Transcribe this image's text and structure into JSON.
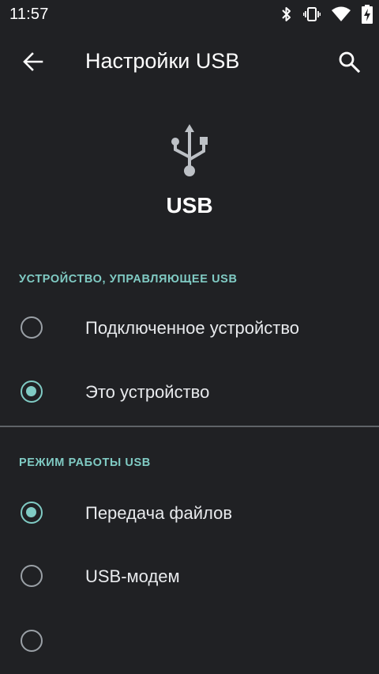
{
  "status_bar": {
    "time": "11:57",
    "icons": [
      "bluetooth-icon",
      "vibrate-icon",
      "wifi-icon",
      "battery-charging-icon"
    ]
  },
  "app_bar": {
    "back_icon": "arrow-back-icon",
    "title": "Настройки USB",
    "search_icon": "search-icon"
  },
  "hero": {
    "icon": "usb-icon",
    "title": "USB"
  },
  "sections": [
    {
      "header": "УСТРОЙСТВО, УПРАВЛЯЮЩЕЕ USB",
      "options": [
        {
          "label": "Подключенное устройство",
          "selected": false
        },
        {
          "label": "Это устройство",
          "selected": true
        }
      ]
    },
    {
      "header": "РЕЖИМ РАБОТЫ USB",
      "options": [
        {
          "label": "Передача файлов",
          "selected": true
        },
        {
          "label": "USB-модем",
          "selected": false
        }
      ]
    }
  ],
  "colors": {
    "background": "#202124",
    "accent": "#80cbc4",
    "text": "#e8eaed",
    "radio_unchecked": "#9aa0a6"
  }
}
